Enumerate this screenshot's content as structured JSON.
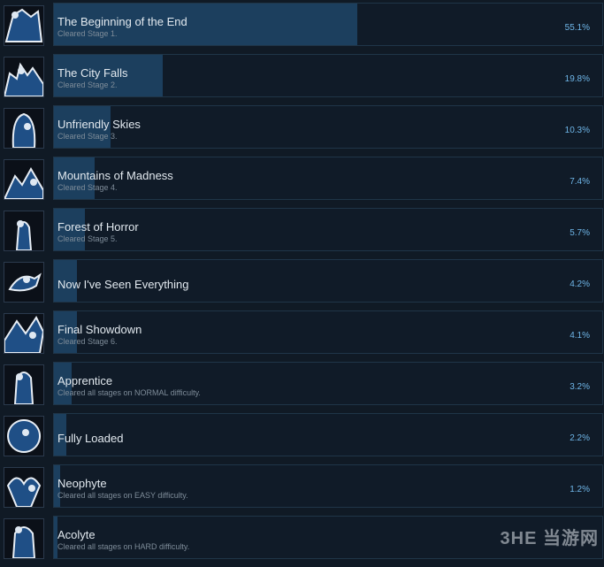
{
  "achievements": [
    {
      "title": "The Beginning of the End",
      "description": "Cleared Stage 1.",
      "percent_label": "55.1%",
      "percent": 55.1,
      "icon": "gothic-heroine-portrait-icon"
    },
    {
      "title": "The City Falls",
      "description": "Cleared Stage 2.",
      "percent_label": "19.8%",
      "percent": 19.8,
      "icon": "fallen-city-art-icon"
    },
    {
      "title": "Unfriendly Skies",
      "description": "Cleared Stage 3.",
      "percent_label": "10.3%",
      "percent": 10.3,
      "icon": "dark-haired-witch-icon"
    },
    {
      "title": "Mountains of Madness",
      "description": "Cleared Stage 4.",
      "percent_label": "7.4%",
      "percent": 7.4,
      "icon": "mountain-moon-art-icon"
    },
    {
      "title": "Forest of Horror",
      "description": "Cleared Stage 5.",
      "percent_label": "5.7%",
      "percent": 5.7,
      "icon": "forest-figure-art-icon"
    },
    {
      "title": "Now I've Seen Everything",
      "description": "",
      "percent_label": "4.2%",
      "percent": 4.2,
      "icon": "crow-art-icon"
    },
    {
      "title": "Final Showdown",
      "description": "Cleared Stage 6.",
      "percent_label": "4.1%",
      "percent": 4.1,
      "icon": "battle-scene-art-icon"
    },
    {
      "title": "Apprentice",
      "description": "Cleared all stages on NORMAL difficulty.",
      "percent_label": "3.2%",
      "percent": 3.2,
      "icon": "cloaked-apprentice-icon"
    },
    {
      "title": "Fully Loaded",
      "description": "",
      "percent_label": "2.2%",
      "percent": 2.2,
      "icon": "round-shield-icon"
    },
    {
      "title": "Neophyte",
      "description": "Cleared all stages on EASY difficulty.",
      "percent_label": "1.2%",
      "percent": 1.2,
      "icon": "winged-girl-art-icon"
    },
    {
      "title": "Acolyte",
      "description": "Cleared all stages on HARD difficulty.",
      "percent_label": "",
      "percent": 0.5,
      "icon": "blue-knight-art-icon"
    }
  ],
  "watermark": "3HE 当游网",
  "colors": {
    "background": "#101a25",
    "bar_fill": "#1c3f5e",
    "percent_text": "#6fb6e8",
    "title_text": "#e2e9ef",
    "description_text": "#7e8c99"
  }
}
